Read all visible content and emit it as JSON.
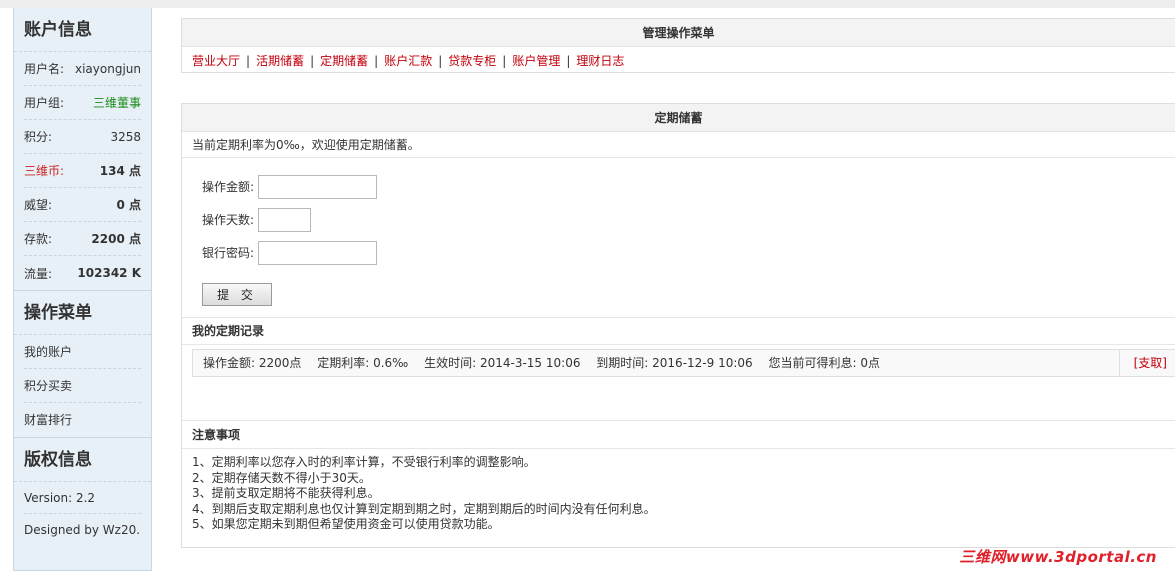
{
  "sidebar": {
    "account_title": "账户信息",
    "rows": [
      {
        "label": "用户名:",
        "value": "xiayongjun"
      },
      {
        "label": "用户组:",
        "value": "三维董事"
      },
      {
        "label": "积分:",
        "value": "3258"
      },
      {
        "label": "三维币:",
        "value": "134 点"
      },
      {
        "label": "威望:",
        "value": "0 点"
      },
      {
        "label": "存款:",
        "value": "2200 点"
      },
      {
        "label": "流量:",
        "value": "102342 K"
      }
    ],
    "menu_title": "操作菜单",
    "menu_items": [
      "我的账户",
      "积分买卖",
      "财富排行"
    ],
    "copyright_title": "版权信息",
    "version": "Version: 2.2",
    "designed_by": "Designed by Wz20..."
  },
  "menu_panel": {
    "title": "管理操作菜单",
    "links": [
      "营业大厅",
      "活期储蓄",
      "定期储蓄",
      "账户汇款",
      "贷款专柜",
      "账户管理",
      "理财日志"
    ],
    "separator": "|"
  },
  "fixed_panel": {
    "title": "定期储蓄",
    "rate_line": "当前定期利率为0‰，欢迎使用定期储蓄。",
    "form": {
      "amount_label": "操作金额:",
      "days_label": "操作天数:",
      "password_label": "银行密码:",
      "amount_value": "",
      "days_value": "",
      "password_value": "",
      "submit_label": "提 交"
    },
    "records_title": "我的定期记录",
    "record": {
      "amount": "操作金额: 2200点",
      "rate": "定期利率: 0.6‰",
      "start": "生效时间: 2014-3-15 10:06",
      "end": "到期时间: 2016-12-9 10:06",
      "interest": "您当前可得利息: 0点",
      "action": "[支取]"
    },
    "notes_title": "注意事项",
    "notes": [
      "1、定期利率以您存入时的利率计算，不受银行利率的调整影响。",
      "2、定期存储天数不得小于30天。",
      "3、提前支取定期将不能获得利息。",
      "4、到期后支取定期利息也仅计算到定期到期之时，定期到期后的时间内没有任何利息。",
      "5、如果您定期未到期但希望使用资金可以使用贷款功能。"
    ]
  },
  "watermark": "三维网www.3dportal.cn",
  "colors": {
    "link_red": "#c0000b",
    "group_green": "#1a8a1a",
    "sidebar_bg": "#e8f0f7"
  }
}
